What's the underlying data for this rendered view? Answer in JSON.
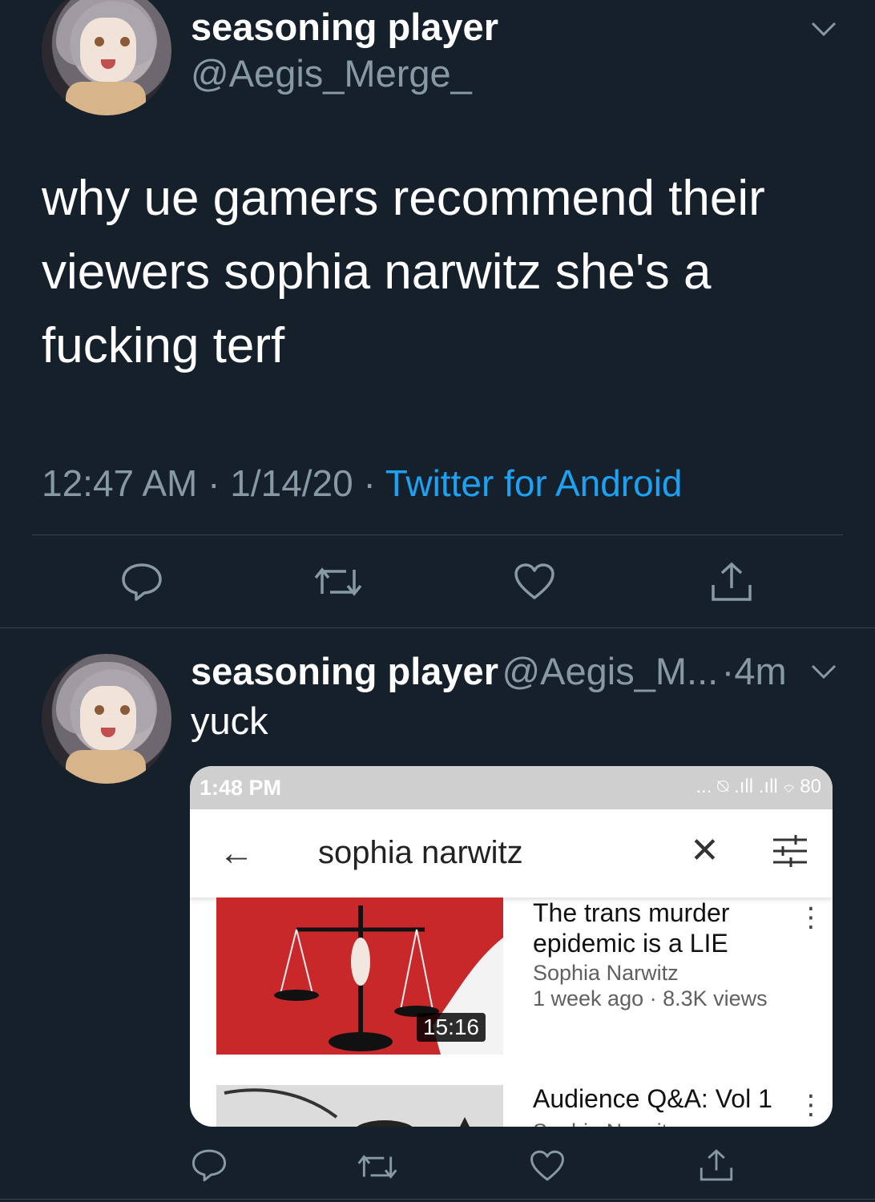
{
  "tweet": {
    "author_name": "seasoning player",
    "author_handle": "@Aegis_Merge_",
    "text": "why ue gamers recommend their viewers sophia narwitz she's a fucking terf",
    "time": "12:47 AM",
    "sep": "·",
    "date": "1/14/20",
    "source": "Twitter for Android"
  },
  "reply": {
    "author_name": "seasoning player",
    "author_handle": "@Aegis_M...",
    "age": "4m",
    "age_sep": "·",
    "text": "yuck"
  },
  "screenshot": {
    "status_time": "1:48 PM",
    "status_icons": "... ⍉ .ıll .ıll ⌔ 80",
    "search_query": "sophia narwitz",
    "results": [
      {
        "title": "The trans murder epidemic is a LIE",
        "channel": "Sophia Narwitz",
        "meta": "1 week ago · 8.3K views",
        "duration": "15:16"
      },
      {
        "title": "Audience Q&A: Vol 1",
        "channel": "Sophia Narwitz"
      }
    ]
  },
  "icons": {
    "reply": "reply-icon",
    "retweet": "retweet-icon",
    "like": "heart-icon",
    "share": "share-icon",
    "caret": "chevron-down-icon",
    "back": "back-arrow-icon",
    "clear": "close-icon",
    "filter": "filter-icon",
    "more": "more-vertical-icon"
  },
  "colors": {
    "background": "#15202b",
    "secondary_text": "#8899a6",
    "link": "#1da1f2",
    "divider": "#38444d"
  }
}
